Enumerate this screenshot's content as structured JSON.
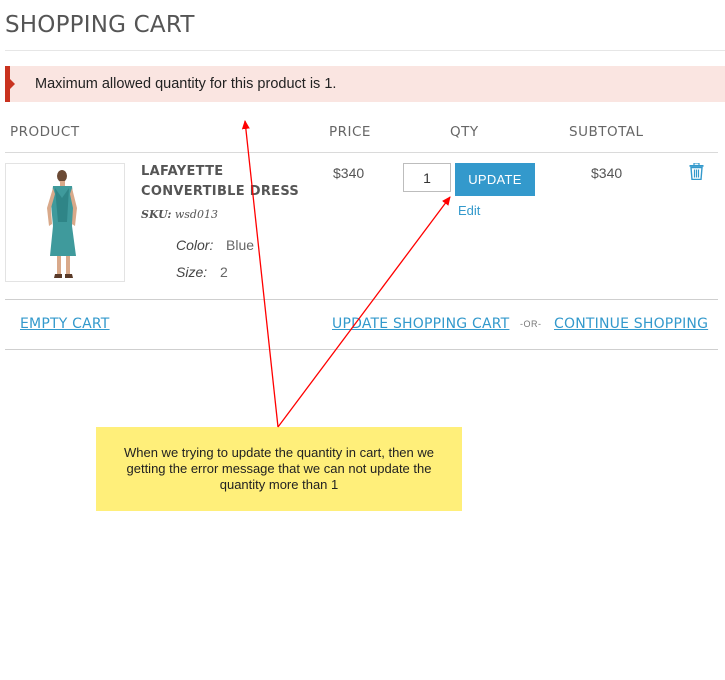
{
  "page": {
    "title": "SHOPPING CART"
  },
  "message": {
    "text": "Maximum allowed quantity for this product is 1."
  },
  "table": {
    "headers": {
      "product": "PRODUCT",
      "price": "PRICE",
      "qty": "QTY",
      "subtotal": "SUBTOTAL"
    }
  },
  "item": {
    "name_line1": "LAFAYETTE",
    "name_line2": "CONVERTIBLE DRESS",
    "sku_label": "SKU:",
    "sku_value": "wsd013",
    "options": [
      {
        "label": "Color:",
        "value": "Blue"
      },
      {
        "label": "Size:",
        "value": "2"
      }
    ],
    "price": "$340",
    "qty": "1",
    "update_label": "UPDATE",
    "edit_label": "Edit",
    "subtotal": "$340",
    "remove_icon": "trash-icon"
  },
  "actions": {
    "empty_cart": "EMPTY CART",
    "update_cart": "UPDATE SHOPPING CART",
    "or": "-OR-",
    "continue": "CONTINUE SHOPPING"
  },
  "annotation": {
    "text": "When we trying to update the quantity in cart, then we getting the error message that we can not update the quantity more than 1"
  },
  "colors": {
    "accent": "#3399cc",
    "error_bg": "#fae5e1",
    "error_marker": "#c9321f",
    "note_bg": "#ffef7a",
    "arrow": "#ff0000"
  }
}
